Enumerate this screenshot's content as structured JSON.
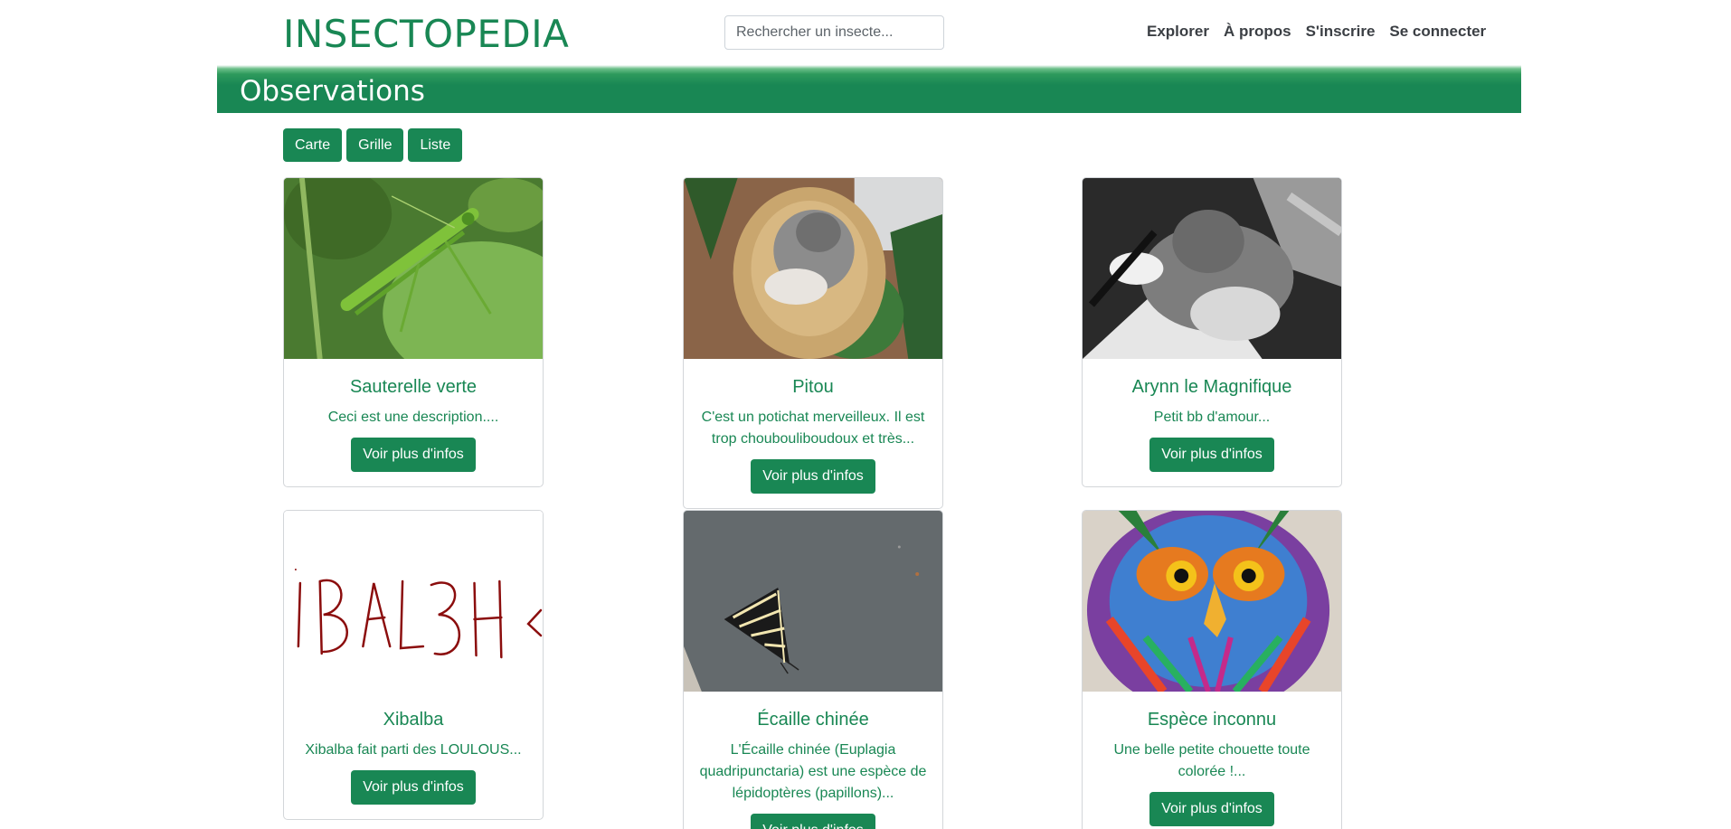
{
  "header": {
    "brand": "INSECTOPEDIA",
    "search_placeholder": "Rechercher un insecte...",
    "nav": [
      "Explorer",
      "À propos",
      "S'inscrire",
      "Se connecter"
    ]
  },
  "banner": {
    "title": "Observations"
  },
  "views": [
    "Carte",
    "Grille",
    "Liste"
  ],
  "cards": [
    {
      "title": "Sauterelle verte",
      "text": "Ceci est une description....",
      "button": "Voir plus d'infos",
      "image": "green grasshopper photo"
    },
    {
      "title": "Pitou",
      "text": "C'est un potichat merveilleux. Il est trop choubouliboudoux et très...",
      "button": "Voir plus d'infos",
      "image": "cat in wicker basket photo"
    },
    {
      "title": "Arynn le Magnifique",
      "text": "Petit bb d'amour...",
      "button": "Voir plus d'infos",
      "image": "grey cat on blanket photo"
    },
    {
      "title": "Xibalba",
      "text": "Xibalba fait parti des LOULOUS...",
      "button": "Voir plus d'infos",
      "image": "handwritten drawing"
    },
    {
      "title": "Écaille chinée",
      "text": "L'Écaille chinée (Euplagia quadripunctaria) est une espèce de lépidoptères (papillons)...",
      "button": "Voir plus d'infos",
      "image": "moth on grey ground photo"
    },
    {
      "title": "Espèce inconnu",
      "text": "Une belle petite chouette toute colorée !...",
      "button": "Voir plus d'infos",
      "image": "colorful owl drawing"
    }
  ],
  "colors": {
    "accent": "#198754"
  }
}
